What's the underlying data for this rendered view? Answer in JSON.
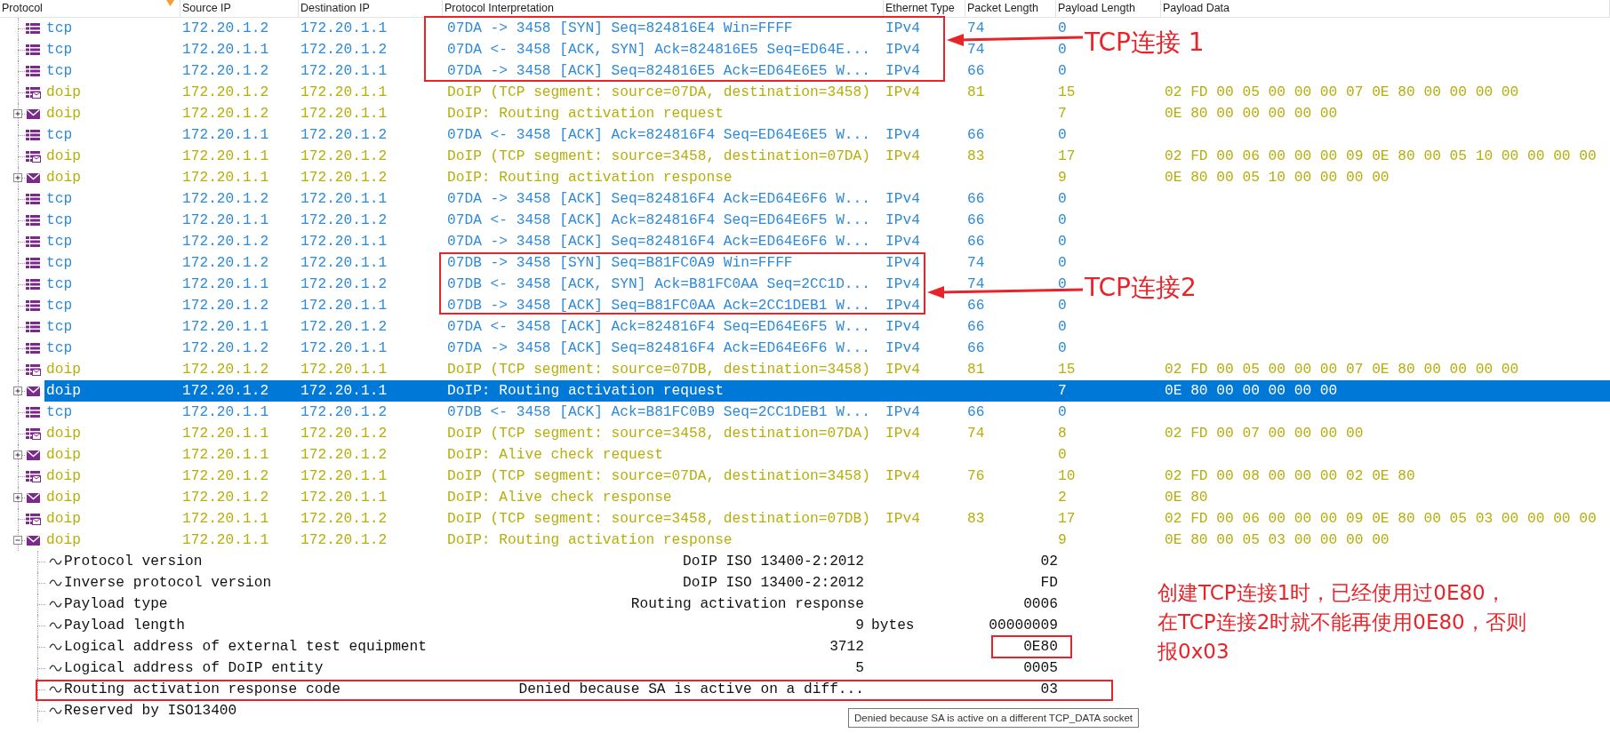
{
  "columns": [
    {
      "label": "Protocol",
      "sorted": true
    },
    {
      "label": "Source IP",
      "sorted": false
    },
    {
      "label": "Destination IP",
      "sorted": false
    },
    {
      "label": "Protocol Interpretation",
      "sorted": false
    },
    {
      "label": "Ethernet Type",
      "sorted": false
    },
    {
      "label": "Packet Length",
      "sorted": false
    },
    {
      "label": "Payload Length",
      "sorted": false
    },
    {
      "label": "Payload Data",
      "sorted": false
    }
  ],
  "packets": [
    {
      "kind": "tcp",
      "protocol": "tcp",
      "source_ip": "172.20.1.2",
      "destination_ip": "172.20.1.1",
      "interpretation": "07DA -> 3458 [SYN] Seq=824816E4 Win=FFFF",
      "ethernet_type": "IPv4",
      "packet_length": "74",
      "payload_length": "0",
      "selected": false
    },
    {
      "kind": "tcp",
      "protocol": "tcp",
      "source_ip": "172.20.1.1",
      "destination_ip": "172.20.1.2",
      "interpretation": "07DA <- 3458 [ACK, SYN] Ack=824816E5 Seq=ED64E...",
      "ethernet_type": "IPv4",
      "packet_length": "74",
      "payload_length": "0",
      "selected": false
    },
    {
      "kind": "tcp",
      "protocol": "tcp",
      "source_ip": "172.20.1.2",
      "destination_ip": "172.20.1.1",
      "interpretation": "07DA -> 3458 [ACK] Seq=824816E5 Ack=ED64E6E5 W...",
      "ethernet_type": "IPv4",
      "packet_length": "66",
      "payload_length": "0",
      "selected": false
    },
    {
      "kind": "segment",
      "protocol": "doip",
      "source_ip": "172.20.1.2",
      "destination_ip": "172.20.1.1",
      "interpretation": "DoIP (TCP segment: source=07DA, destination=3458)",
      "ethernet_type": "IPv4",
      "packet_length": "81",
      "payload_length": "15",
      "payload_data": "02 FD 00 05 00 00 00 07 0E 80 00 00 00 00",
      "selected": false
    },
    {
      "kind": "message",
      "protocol": "doip",
      "source_ip": "172.20.1.2",
      "destination_ip": "172.20.1.1",
      "interpretation": "DoIP: Routing activation request",
      "payload_length": "7",
      "payload_data": "0E 80 00 00 00 00 00",
      "selected": false,
      "expanded": false
    },
    {
      "kind": "tcp",
      "protocol": "tcp",
      "source_ip": "172.20.1.1",
      "destination_ip": "172.20.1.2",
      "interpretation": "07DA <- 3458 [ACK] Ack=824816F4 Seq=ED64E6E5 W...",
      "ethernet_type": "IPv4",
      "packet_length": "66",
      "payload_length": "0",
      "selected": false
    },
    {
      "kind": "segment",
      "protocol": "doip",
      "source_ip": "172.20.1.1",
      "destination_ip": "172.20.1.2",
      "interpretation": "DoIP (TCP segment: source=3458, destination=07DA)",
      "ethernet_type": "IPv4",
      "packet_length": "83",
      "payload_length": "17",
      "payload_data": "02 FD 00 06 00 00 00 09 0E 80 00 05 10 00 00 00 00",
      "selected": false
    },
    {
      "kind": "message",
      "protocol": "doip",
      "source_ip": "172.20.1.1",
      "destination_ip": "172.20.1.2",
      "interpretation": "DoIP: Routing activation response",
      "payload_length": "9",
      "payload_data": "0E 80 00 05 10 00 00 00 00",
      "selected": false,
      "expanded": false
    },
    {
      "kind": "tcp",
      "protocol": "tcp",
      "source_ip": "172.20.1.2",
      "destination_ip": "172.20.1.1",
      "interpretation": "07DA -> 3458 [ACK] Seq=824816F4 Ack=ED64E6F6 W...",
      "ethernet_type": "IPv4",
      "packet_length": "66",
      "payload_length": "0",
      "selected": false
    },
    {
      "kind": "tcp",
      "protocol": "tcp",
      "source_ip": "172.20.1.1",
      "destination_ip": "172.20.1.2",
      "interpretation": "07DA <- 3458 [ACK] Ack=824816F4 Seq=ED64E6F5 W...",
      "ethernet_type": "IPv4",
      "packet_length": "66",
      "payload_length": "0",
      "selected": false
    },
    {
      "kind": "tcp",
      "protocol": "tcp",
      "source_ip": "172.20.1.2",
      "destination_ip": "172.20.1.1",
      "interpretation": "07DA -> 3458 [ACK] Seq=824816F4 Ack=ED64E6F6 W...",
      "ethernet_type": "IPv4",
      "packet_length": "66",
      "payload_length": "0",
      "selected": false
    },
    {
      "kind": "tcp",
      "protocol": "tcp",
      "source_ip": "172.20.1.2",
      "destination_ip": "172.20.1.1",
      "interpretation": "07DB -> 3458 [SYN] Seq=B81FC0A9 Win=FFFF",
      "ethernet_type": "IPv4",
      "packet_length": "74",
      "payload_length": "0",
      "selected": false
    },
    {
      "kind": "tcp",
      "protocol": "tcp",
      "source_ip": "172.20.1.1",
      "destination_ip": "172.20.1.2",
      "interpretation": "07DB <- 3458 [ACK, SYN] Ack=B81FC0AA Seq=2CC1D...",
      "ethernet_type": "IPv4",
      "packet_length": "74",
      "payload_length": "0",
      "selected": false
    },
    {
      "kind": "tcp",
      "protocol": "tcp",
      "source_ip": "172.20.1.2",
      "destination_ip": "172.20.1.1",
      "interpretation": "07DB -> 3458 [ACK] Seq=B81FC0AA Ack=2CC1DEB1 W...",
      "ethernet_type": "IPv4",
      "packet_length": "66",
      "payload_length": "0",
      "selected": false
    },
    {
      "kind": "tcp",
      "protocol": "tcp",
      "source_ip": "172.20.1.1",
      "destination_ip": "172.20.1.2",
      "interpretation": "07DA <- 3458 [ACK] Ack=824816F4 Seq=ED64E6F5 W...",
      "ethernet_type": "IPv4",
      "packet_length": "66",
      "payload_length": "0",
      "selected": false
    },
    {
      "kind": "tcp",
      "protocol": "tcp",
      "source_ip": "172.20.1.2",
      "destination_ip": "172.20.1.1",
      "interpretation": "07DA -> 3458 [ACK] Seq=824816F4 Ack=ED64E6F6 W...",
      "ethernet_type": "IPv4",
      "packet_length": "66",
      "payload_length": "0",
      "selected": false
    },
    {
      "kind": "segment",
      "protocol": "doip",
      "source_ip": "172.20.1.2",
      "destination_ip": "172.20.1.1",
      "interpretation": "DoIP (TCP segment: source=07DB, destination=3458)",
      "ethernet_type": "IPv4",
      "packet_length": "81",
      "payload_length": "15",
      "payload_data": "02 FD 00 05 00 00 00 07 0E 80 00 00 00 00",
      "selected": false
    },
    {
      "kind": "message",
      "protocol": "doip",
      "source_ip": "172.20.1.2",
      "destination_ip": "172.20.1.1",
      "interpretation": "DoIP: Routing activation request",
      "payload_length": "7",
      "payload_data": "0E 80 00 00 00 00 00",
      "selected": true,
      "expanded": false
    },
    {
      "kind": "tcp",
      "protocol": "tcp",
      "source_ip": "172.20.1.1",
      "destination_ip": "172.20.1.2",
      "interpretation": "07DB <- 3458 [ACK] Ack=B81FC0B9 Seq=2CC1DEB1 W...",
      "ethernet_type": "IPv4",
      "packet_length": "66",
      "payload_length": "0",
      "selected": false
    },
    {
      "kind": "segment",
      "protocol": "doip",
      "source_ip": "172.20.1.1",
      "destination_ip": "172.20.1.2",
      "interpretation": "DoIP (TCP segment: source=3458, destination=07DA)",
      "ethernet_type": "IPv4",
      "packet_length": "74",
      "payload_length": "8",
      "payload_data": "02 FD 00 07 00 00 00 00",
      "selected": false
    },
    {
      "kind": "message",
      "protocol": "doip",
      "source_ip": "172.20.1.1",
      "destination_ip": "172.20.1.2",
      "interpretation": "DoIP: Alive check request",
      "payload_length": "0",
      "selected": false,
      "expanded": false
    },
    {
      "kind": "segment",
      "protocol": "doip",
      "source_ip": "172.20.1.2",
      "destination_ip": "172.20.1.1",
      "interpretation": "DoIP (TCP segment: source=07DA, destination=3458)",
      "ethernet_type": "IPv4",
      "packet_length": "76",
      "payload_length": "10",
      "payload_data": "02 FD 00 08 00 00 00 02 0E 80",
      "selected": false
    },
    {
      "kind": "message",
      "protocol": "doip",
      "source_ip": "172.20.1.2",
      "destination_ip": "172.20.1.1",
      "interpretation": "DoIP: Alive check response",
      "payload_length": "2",
      "payload_data": "0E 80",
      "selected": false,
      "expanded": false
    },
    {
      "kind": "segment",
      "protocol": "doip",
      "source_ip": "172.20.1.1",
      "destination_ip": "172.20.1.2",
      "interpretation": "DoIP (TCP segment: source=3458, destination=07DB)",
      "ethernet_type": "IPv4",
      "packet_length": "83",
      "payload_length": "17",
      "payload_data": "02 FD 00 06 00 00 00 09 0E 80 00 05 03 00 00 00 00",
      "selected": false
    },
    {
      "kind": "message",
      "protocol": "doip",
      "source_ip": "172.20.1.1",
      "destination_ip": "172.20.1.2",
      "interpretation": "DoIP: Routing activation response",
      "payload_length": "9",
      "payload_data": "0E 80 00 05 03 00 00 00 00",
      "selected": false,
      "expanded": true,
      "children": [
        {
          "name": "Protocol version",
          "value": "DoIP ISO 13400-2:2012",
          "raw": "02"
        },
        {
          "name": "Inverse protocol version",
          "value": "DoIP ISO 13400-2:2012",
          "raw": "FD"
        },
        {
          "name": "Payload type",
          "value": "Routing activation response",
          "raw": "0006"
        },
        {
          "name": "Payload length",
          "value": "9",
          "unit": "bytes",
          "raw": "00000009"
        },
        {
          "name": "Logical address of external test equipment",
          "value": "3712",
          "raw": "0E80"
        },
        {
          "name": "Logical address of DoIP entity",
          "value": "5",
          "raw": "0005"
        },
        {
          "name": "Routing activation response code",
          "value": "Denied because SA is active on a diff...",
          "raw": "03"
        },
        {
          "name": "Reserved by ISO13400"
        }
      ]
    }
  ],
  "annotations": {
    "callouts": [
      "TCP连接 1",
      "TCP连接2"
    ],
    "note_lines": [
      "创建TCP连接1时，已经使用过0E80，",
      "在TCP连接2时就不能再使用0E80，否则",
      "报0x03"
    ]
  },
  "tooltip": {
    "text": "Denied because SA is active on a different TCP_DATA socket"
  }
}
